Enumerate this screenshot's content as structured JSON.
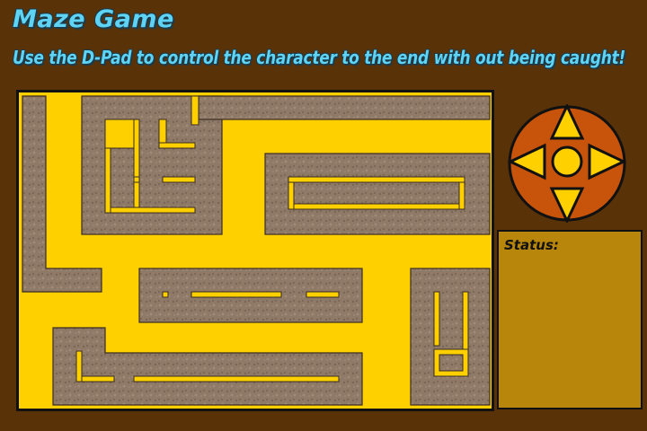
{
  "header": {
    "title": "Maze Game",
    "instructions": "Use the D-Pad to control the character to the end with out being caught!"
  },
  "status": {
    "label": "Status:",
    "text": ""
  },
  "dpad": {
    "directions": [
      "up",
      "down",
      "left",
      "right",
      "center"
    ]
  },
  "colors": {
    "background": "#5a3208",
    "maze_path": "#ffd000",
    "maze_wall": "#8f7a68",
    "dpad_fill": "#c8540c",
    "dpad_arrow": "#ffd000",
    "status_panel": "#b8860b",
    "title": "#5fd3f3"
  }
}
